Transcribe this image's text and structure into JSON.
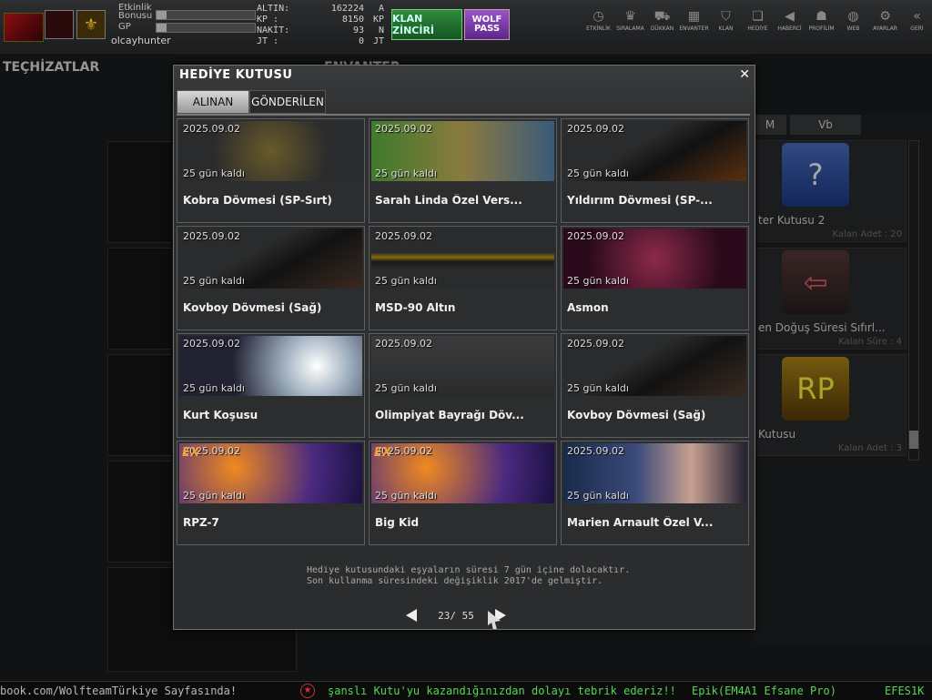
{
  "header": {
    "username": "olcayhunter",
    "etkinlik_label": "Etkinlik",
    "bonus_label": "Bonusu",
    "gp_label": "GP",
    "currencies": [
      {
        "label": "ALTIN:",
        "value": "162224",
        "unit": "A"
      },
      {
        "label": "KP :",
        "value": "8150",
        "unit": "KP"
      },
      {
        "label": "NAKİT:",
        "value": "93",
        "unit": "N"
      },
      {
        "label": "JT :",
        "value": "0",
        "unit": "JT"
      }
    ],
    "klan_button": "KLAN ZİNCİRİ",
    "wolf_pass_button": "WOLF PASS",
    "nav": [
      {
        "label": "ETKİNLİK",
        "icon": "clock-icon"
      },
      {
        "label": "SIRALAMA",
        "icon": "ranking-icon"
      },
      {
        "label": "DÜKKAN",
        "icon": "cart-icon"
      },
      {
        "label": "ENVANTER",
        "icon": "inventory-icon"
      },
      {
        "label": "KLAN",
        "icon": "shield-icon"
      },
      {
        "label": "HEDİYE",
        "icon": "gift-icon"
      },
      {
        "label": "HABERCİ",
        "icon": "megaphone-icon"
      },
      {
        "label": "PROFİLİM",
        "icon": "profile-icon"
      },
      {
        "label": "WEB",
        "icon": "globe-icon"
      },
      {
        "label": "AYARLAR",
        "icon": "gear-icon"
      },
      {
        "label": "GERİ",
        "icon": "back-icon"
      }
    ]
  },
  "background": {
    "left_title": "TEÇHİZATLAR",
    "center_title": "ENVANTER",
    "right_tabs": [
      "M",
      "Vb"
    ],
    "right_items": [
      {
        "name": "ter Kutusu 2",
        "count": "Kalan Adet : 20"
      },
      {
        "name": "en Doğuş Süresi Sıfırl...",
        "count": "Kalan Süre : 4"
      },
      {
        "name": "Kutusu",
        "count": "Kalan Adet : 3"
      }
    ]
  },
  "dialog": {
    "title": "HEDİYE KUTUSU",
    "tabs": [
      "ALINAN",
      "GÖNDERİLEN"
    ],
    "active_tab": "ALINAN",
    "items": [
      {
        "date": "2025.09.02",
        "left": "25 gün kaldı",
        "name": "Kobra Dövmesi (SP-Sırt)",
        "ex": ""
      },
      {
        "date": "2025.09.02",
        "left": "25 gün kaldı",
        "name": "Sarah Linda Özel Vers...",
        "ex": ""
      },
      {
        "date": "2025.09.02",
        "left": "25 gün kaldı",
        "name": "Yıldırım Dövmesi (SP-...",
        "ex": ""
      },
      {
        "date": "2025.09.02",
        "left": "25 gün kaldı",
        "name": "Kovboy Dövmesi (Sağ)",
        "ex": ""
      },
      {
        "date": "2025.09.02",
        "left": "25 gün kaldı",
        "name": "MSD-90 Altın",
        "ex": ""
      },
      {
        "date": "2025.09.02",
        "left": "25 gün kaldı",
        "name": "Asmon",
        "ex": ""
      },
      {
        "date": "2025.09.02",
        "left": "25 gün kaldı",
        "name": "Kurt Koşusu",
        "ex": ""
      },
      {
        "date": "2025.09.02",
        "left": "25 gün kaldı",
        "name": "Olimpiyat Bayrağı Döv...",
        "ex": ""
      },
      {
        "date": "2025.09.02",
        "left": "25 gün kaldı",
        "name": "Kovboy Dövmesi (Sağ)",
        "ex": ""
      },
      {
        "date": "2025.09.02",
        "left": "25 gün kaldı",
        "name": "RPZ-7",
        "ex": "EX"
      },
      {
        "date": "2025.09.02",
        "left": "25 gün kaldı",
        "name": "Big Kid",
        "ex": "EX"
      },
      {
        "date": "2025.09.02",
        "left": "25 gün kaldı",
        "name": "Marien Arnault Özel V...",
        "ex": ""
      }
    ],
    "note_line1": "Hediye kutusundaki eşyaların süresi 7 gün içine dolacaktır.",
    "note_line2": "Son kullanma süresindeki değişiklik 2017'de gelmiştir.",
    "page_text": "23/ 55"
  },
  "ticker": {
    "left": "book.com/WolfteamTürkiye Sayfasında!",
    "middle": "şanslı Kutu'yu kazandığınızdan dolayı tebrik ederiz!!",
    "right": "Epik(EM4A1 Efsane Pro)",
    "far_right": "EFES1K"
  }
}
